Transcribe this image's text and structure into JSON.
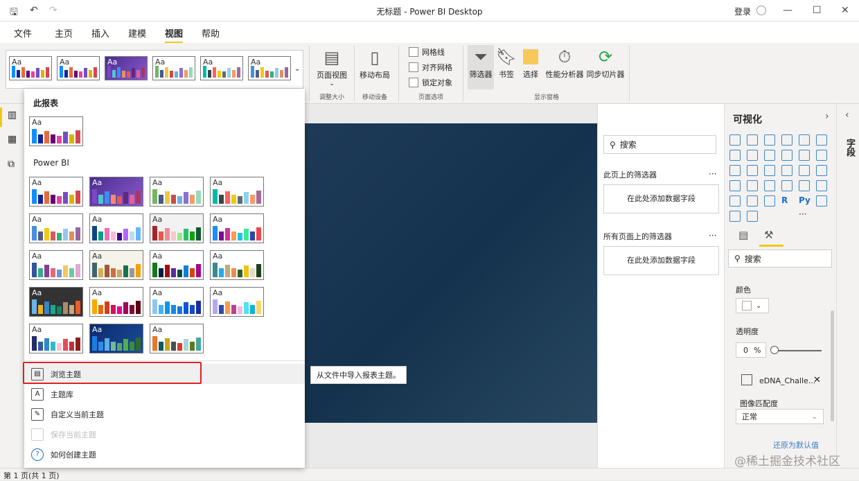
{
  "title": "无标题 - Power BI Desktop",
  "login": "登录",
  "tabs": [
    "文件",
    "主页",
    "插入",
    "建模",
    "视图",
    "帮助"
  ],
  "ribbon": {
    "page_view": "页面视图",
    "mobile_layout": "移动布局",
    "gridlines": "网格线",
    "snap_grid": "对齐网格",
    "lock_objects": "锁定对象",
    "filters": "筛选器",
    "bookmarks": "书签",
    "selection": "选择",
    "perf_analyzer": "性能分析器",
    "sync_slicers": "同步切片器",
    "groups": [
      "调整大小",
      "移动设备",
      "页面选项",
      "显示窗格"
    ]
  },
  "menu": {
    "this_report": "此报表",
    "power_bi": "Power BI",
    "items": [
      "浏览主题",
      "主题库",
      "自定义当前主题",
      "保存当前主题",
      "如何创建主题"
    ],
    "tooltip": "从文件中导入报表主题。"
  },
  "themes": [
    {
      "bg": "#fff",
      "fg": "#333",
      "colors": [
        "#118dff",
        "#12239e",
        "#e66c37",
        "#6b007b",
        "#e044a7",
        "#744ec2",
        "#d9b300",
        "#d64550"
      ]
    },
    {
      "bg": "linear-gradient(135deg,#4a2d8f,#8a5acb)",
      "fg": "#fff",
      "colors": [
        "#7c46c4",
        "#4ec5d6",
        "#3a8df0",
        "#f58b6b",
        "#e8594b",
        "#5c2a84",
        "#e55f9b",
        "#a2396a"
      ]
    },
    {
      "bg": "#fff",
      "fg": "#333",
      "colors": [
        "#73b761",
        "#4a588a",
        "#ecc846",
        "#cd4c46",
        "#71afe2",
        "#8d6fd1",
        "#ee9e64",
        "#95dabb"
      ]
    },
    {
      "bg": "#fff",
      "fg": "#333",
      "colors": [
        "#01b8aa",
        "#374649",
        "#fd625e",
        "#f2c80f",
        "#5f6b6d",
        "#8ad4eb",
        "#fe9666",
        "#a66999"
      ]
    },
    {
      "bg": "#fff",
      "fg": "#333",
      "colors": [
        "#4a8ddc",
        "#4c5d8a",
        "#f3c911",
        "#dc5b57",
        "#33ae81",
        "#95c8f0",
        "#dd915f",
        "#9a64a0"
      ]
    },
    {
      "bg": "#fff",
      "fg": "#333",
      "colors": [
        "#094782",
        "#0b9e8c",
        "#f06fb0",
        "#f9b9d6",
        "#3c048b",
        "#b565ff",
        "#b8dcf5",
        "#67b5ff"
      ]
    },
    {
      "bg": "#f2f2f2",
      "fg": "#333",
      "colors": [
        "#a4262c",
        "#e8584b",
        "#f28a90",
        "#f9c9cc",
        "#95e886",
        "#2dbe6c",
        "#13a10e",
        "#0e5c2f"
      ]
    },
    {
      "bg": "#fff",
      "fg": "#333",
      "colors": [
        "#1e8cff",
        "#7a0e8d",
        "#d3329a",
        "#f89c52",
        "#20c3e8",
        "#3bea9d",
        "#3046a8",
        "#f0474f"
      ]
    },
    {
      "bg": "#fff",
      "fg": "#333",
      "colors": [
        "#31569e",
        "#36aa93",
        "#8a3c90",
        "#e06a7b",
        "#6e94d4",
        "#f2c864",
        "#6ec7a0",
        "#e1a8cf"
      ]
    },
    {
      "bg": "#f5f3ea",
      "fg": "#333",
      "colors": [
        "#3d6672",
        "#d5af54",
        "#9d5a3a",
        "#cf6d43",
        "#cda36b",
        "#12744d",
        "#9c9890",
        "#f4a00a"
      ]
    },
    {
      "bg": "#fff",
      "fg": "#333",
      "colors": [
        "#137a16",
        "#002047",
        "#a20f0f",
        "#5d2aa0",
        "#054b4b",
        "#0a80d6",
        "#d94205",
        "#a6048f"
      ]
    },
    {
      "bg": "#fff",
      "fg": "#333",
      "colors": [
        "#3b8a90",
        "#22aaf0",
        "#c2a87e",
        "#ed8d48",
        "#2d5f28",
        "#f2c112",
        "#dedbc8",
        "#1d3f1b"
      ]
    },
    {
      "bg": "#333",
      "fg": "#fff",
      "colors": [
        "#6cb4e6",
        "#f3b11b",
        "#3686c9",
        "#19a88d",
        "#108a5a",
        "#a88b70",
        "#c8aa78",
        "#f15a29"
      ]
    },
    {
      "bg": "#fff",
      "fg": "#333",
      "colors": [
        "#f9a800",
        "#e86a05",
        "#d43d1b",
        "#d3105c",
        "#e7009a",
        "#9c0a58",
        "#7e0738",
        "#5a0010"
      ]
    },
    {
      "bg": "#fff",
      "fg": "#333",
      "colors": [
        "#8ac7f2",
        "#46b2f6",
        "#0c95e8",
        "#1a86e8",
        "#1577e0",
        "#0e55d8",
        "#1949c8",
        "#14309c"
      ]
    },
    {
      "bg": "#fff",
      "fg": "#333",
      "colors": [
        "#b3a9f2",
        "#2f49b0",
        "#fa9c46",
        "#c23e8e",
        "#fbb6da",
        "#48e7f4",
        "#12b2d4",
        "#fdd46a"
      ]
    },
    {
      "bg": "#fff",
      "fg": "#333",
      "colors": [
        "#232c6b",
        "#2c5ca5",
        "#3289c8",
        "#2fb8d0",
        "#fac2cd",
        "#e34c5a",
        "#bc303c",
        "#8c1f1c"
      ]
    },
    {
      "bg": "linear-gradient(135deg,#0c2a6a,#1a4d9a)",
      "fg": "#fff",
      "colors": [
        "#1a7de0",
        "#2b8de8",
        "#5aafe8",
        "#74b7a0",
        "#5aa66a",
        "#4fb04a",
        "#3d8c3c",
        "#2e6b2f"
      ]
    },
    {
      "bg": "#fff",
      "fg": "#333",
      "colors": [
        "#e8772e",
        "#0e5a63",
        "#c8a51a",
        "#4c4c56",
        "#d83b2b",
        "#a7d6d4",
        "#5b7b1e",
        "#48a5a0"
      ]
    }
  ],
  "filters": {
    "search": "搜索",
    "this_page": "此页上的筛选器",
    "all_pages": "所有页面上的筛选器",
    "add_field": "在此处添加数据字段",
    "more": "···"
  },
  "viz": {
    "title": "可视化",
    "search": "搜索",
    "color_label": "颜色",
    "transparency_label": "透明度",
    "transparency_value": "0",
    "pct": "%",
    "image_name": "eDNA_Challe...",
    "fit_label": "图像匹配度",
    "fit_value": "正常",
    "reset": "还原为默认值",
    "more": "···",
    "r": "R",
    "py": "Py"
  },
  "fields_tab": "字段",
  "status": "第 1 页(共 1 页)",
  "watermark": "@稀土掘金技术社区"
}
